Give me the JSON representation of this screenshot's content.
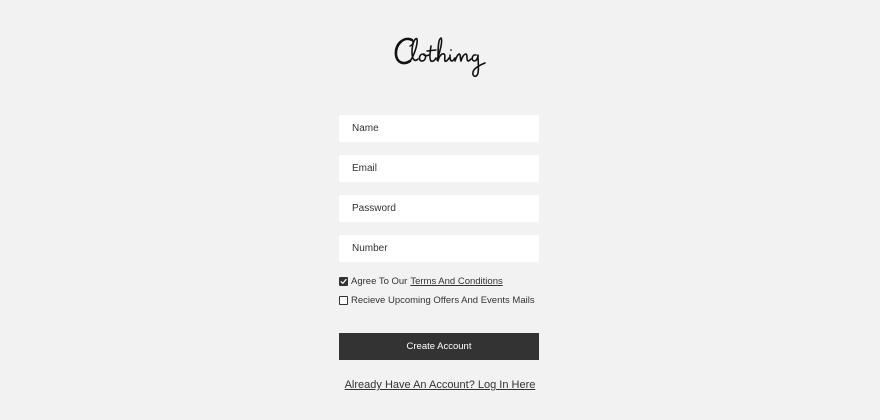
{
  "brand": {
    "logo_text": "Clothing"
  },
  "form": {
    "name_placeholder": "Name",
    "email_placeholder": "Email",
    "password_placeholder": "Password",
    "number_placeholder": "Number"
  },
  "checkboxes": {
    "terms": {
      "checked": true,
      "label_prefix": "Agree To Our",
      "link_text": "Terms And Conditions"
    },
    "offers": {
      "checked": false,
      "label": "Recieve Upcoming Offers And Events Mails"
    }
  },
  "actions": {
    "create_account_label": "Create Account",
    "login_link_text": "Already Have An Account? Log In Here"
  },
  "colors": {
    "page_background": "#f2f2f2",
    "button_background": "#333333",
    "text": "#333333"
  }
}
